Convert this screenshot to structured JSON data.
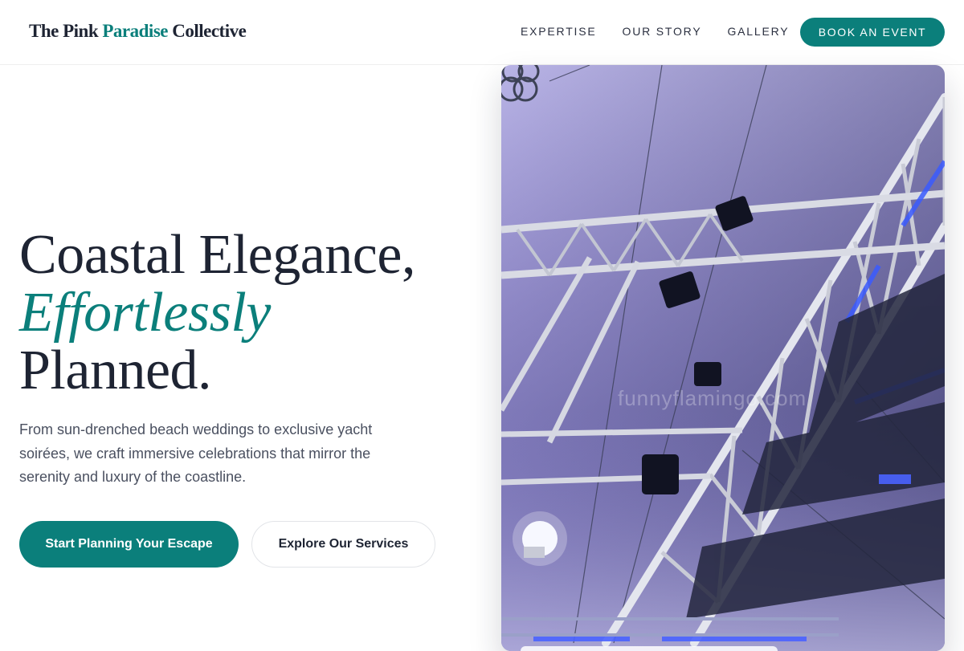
{
  "header": {
    "brand": {
      "part1": "The Pink ",
      "accent": "Paradise",
      "part2": " Collective"
    },
    "nav": [
      {
        "label": "EXPERTISE"
      },
      {
        "label": "OUR STORY"
      },
      {
        "label": "GALLERY"
      }
    ],
    "cta_label": "BOOK AN EVENT"
  },
  "hero": {
    "headline_line1": "Coastal Elegance,",
    "headline_line2": "Effortlessly",
    "headline_line3": "Planned.",
    "lede": "From sun-drenched beach weddings to exclusive yacht soirées, we craft immersive celebrations that mirror the serenity and luxury of the coastline.",
    "primary_cta": "Start Planning Your Escape",
    "secondary_cta": "Explore Our Services",
    "photo_watermark": "funnyflamingo.com"
  },
  "colors": {
    "accent": "#0b7f7b",
    "text_dark": "#1e2433",
    "text_muted": "#4a5060"
  }
}
